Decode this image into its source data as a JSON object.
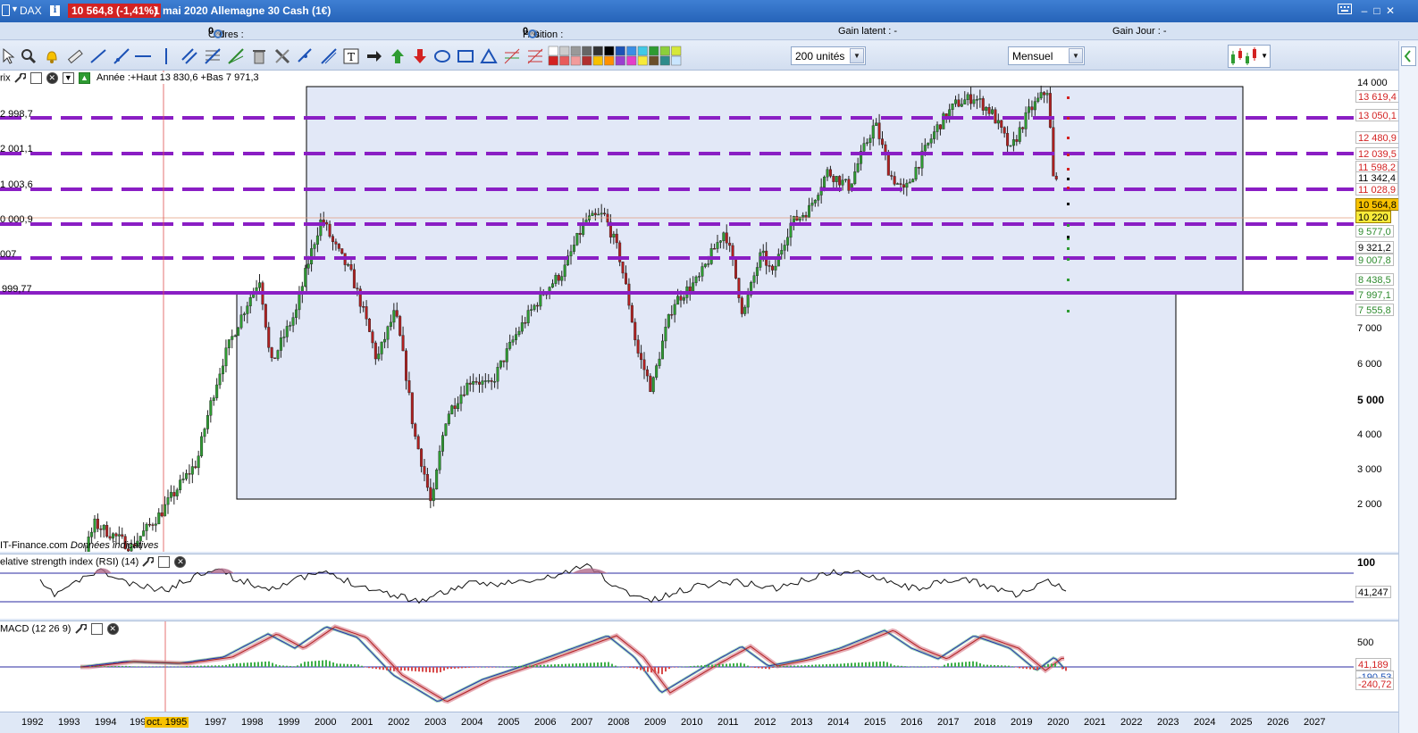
{
  "titlebar": {
    "instrument": "DAX",
    "price_badge": "10 564,8 (-1,41%)",
    "title": "1 mai 2020 Allemagne 30 Cash (1€)",
    "colors": {
      "bar": "#2663b8",
      "badge": "#d32222"
    }
  },
  "status": {
    "orders_label": "Ordres :",
    "orders_value": "0",
    "orders_sep": "/ 0",
    "position_label": "Position :",
    "position_value": "0",
    "position_sep": "/ 0",
    "latent_gain": "Gain latent : -",
    "day_gain": "Gain Jour : -"
  },
  "toolbar": {
    "units_value": "200 unités",
    "period_value": "Mensuel"
  },
  "price_panel": {
    "label_prefix": "rix",
    "year_info": "Année :+Haut 13 830,6 +Bas 7 971,3",
    "left_levels": [
      "2 998,7",
      "2 001,1",
      "1 003,6",
      "0 000,9",
      "007",
      "999,77"
    ],
    "source": "IT-Finance.com",
    "source_note": "Données indicatives",
    "axis_ticks": [
      "14 000",
      "7 000",
      "6 000",
      "5 000",
      "4 000",
      "3 000",
      "2 000"
    ],
    "level_tags": [
      {
        "text": "13 619,4",
        "color": "#d32222"
      },
      {
        "text": "13 050,1",
        "color": "#d32222"
      },
      {
        "text": "12 480,9",
        "color": "#d32222"
      },
      {
        "text": "12 039,5",
        "color": "#d32222"
      },
      {
        "text": "11 598,2",
        "color": "#d32222"
      },
      {
        "text": "11 342,4",
        "color": "#000000"
      },
      {
        "text": "11 028,9",
        "color": "#d32222"
      },
      {
        "text": "10 564,8",
        "color": "#000000",
        "bg": "#f7c100"
      },
      {
        "text": "10 220",
        "color": "#000000",
        "bg": "#f7ea3a"
      },
      {
        "text": "9 577,0",
        "color": "#2e8b2e"
      },
      {
        "text": "9 321,2",
        "color": "#000000"
      },
      {
        "text": "9 007,8",
        "color": "#2e8b2e"
      },
      {
        "text": "8 438,5",
        "color": "#2e8b2e"
      },
      {
        "text": "7 997,1",
        "color": "#2e8b2e"
      },
      {
        "text": "7 555,8",
        "color": "#2e8b2e"
      }
    ],
    "line_color": "#8a1ec4"
  },
  "rsi_panel": {
    "label": "elative strength index (RSI) (14)",
    "axis_top": "100",
    "value": "41,247"
  },
  "macd_panel": {
    "label": "MACD (12 26 9)",
    "axis_top": "500",
    "value1": "41,189",
    "value2": "-190,53",
    "value3": "-240,72"
  },
  "xaxis": {
    "years": [
      "1992",
      "1993",
      "1994",
      "199",
      "1997",
      "1998",
      "1999",
      "2000",
      "2001",
      "2002",
      "2003",
      "2004",
      "2005",
      "2006",
      "2007",
      "2008",
      "2009",
      "2010",
      "2011",
      "2012",
      "2013",
      "2014",
      "2015",
      "2016",
      "2017",
      "2018",
      "2019",
      "2020",
      "2021",
      "2022",
      "2023",
      "2024",
      "2025",
      "2026",
      "2027"
    ],
    "cursor": "oct. 1995"
  }
}
